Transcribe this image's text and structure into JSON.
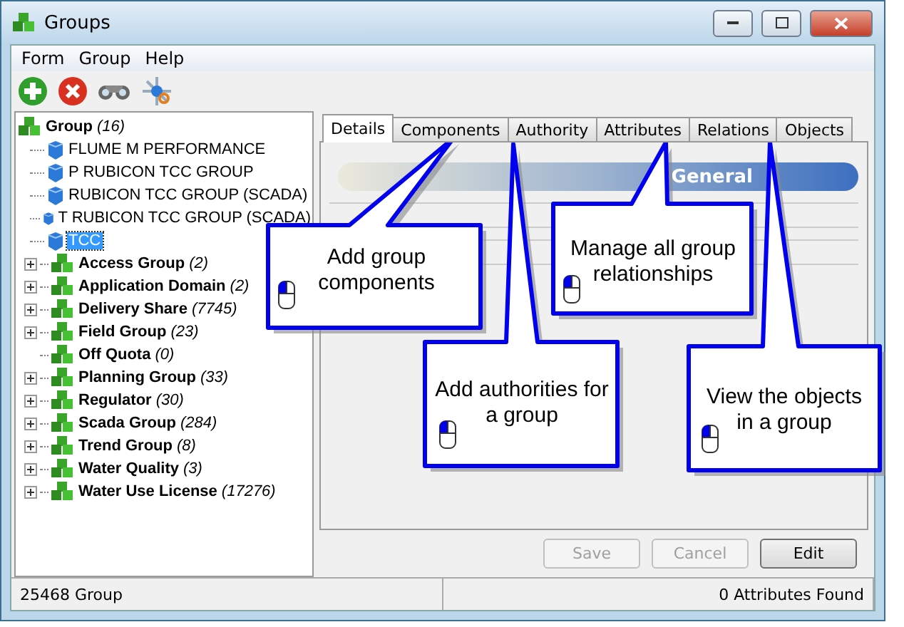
{
  "window": {
    "title": "Groups"
  },
  "menu": [
    "Form",
    "Group",
    "Help"
  ],
  "tree": {
    "label": "Group",
    "count": "(16)",
    "children": [
      {
        "label": "FLUME M PERFORMANCE",
        "kind": "leaf",
        "selected": false
      },
      {
        "label": "P RUBICON TCC GROUP",
        "kind": "leaf",
        "selected": false
      },
      {
        "label": "RUBICON TCC GROUP (SCADA)",
        "kind": "leaf",
        "selected": false
      },
      {
        "label": "T RUBICON TCC GROUP (SCADA)",
        "kind": "leaf",
        "selected": false
      },
      {
        "label": "TCC",
        "kind": "leaf",
        "selected": true
      }
    ]
  },
  "groups": [
    {
      "label": "Access Group",
      "count": "(2)",
      "expandable": true
    },
    {
      "label": "Application Domain",
      "count": "(2)",
      "expandable": true
    },
    {
      "label": "Delivery Share",
      "count": "(7745)",
      "expandable": true
    },
    {
      "label": "Field Group",
      "count": "(23)",
      "expandable": true
    },
    {
      "label": "Off Quota",
      "count": "(0)",
      "expandable": false
    },
    {
      "label": "Planning Group",
      "count": "(33)",
      "expandable": true
    },
    {
      "label": "Regulator",
      "count": "(30)",
      "expandable": true
    },
    {
      "label": "Scada Group",
      "count": "(284)",
      "expandable": true
    },
    {
      "label": "Trend Group",
      "count": "(8)",
      "expandable": true
    },
    {
      "label": "Water Quality",
      "count": "(3)",
      "expandable": true
    },
    {
      "label": "Water Use License",
      "count": "(17276)",
      "expandable": true
    }
  ],
  "tabs": [
    {
      "label": "Details",
      "selected": true
    },
    {
      "label": "Components",
      "selected": false
    },
    {
      "label": "Authority",
      "selected": false
    },
    {
      "label": "Attributes",
      "selected": false
    },
    {
      "label": "Relations",
      "selected": false
    },
    {
      "label": "Objects",
      "selected": false
    }
  ],
  "section": "General",
  "buttons": [
    {
      "label": "Save",
      "disabled": true
    },
    {
      "label": "Cancel",
      "disabled": true
    },
    {
      "label": "Edit",
      "disabled": false
    }
  ],
  "status_bar": [
    "25468 Group",
    "0 Attributes Found"
  ],
  "callouts": [
    "Add group components",
    "Add authorities for a group",
    "Manage all group relationships",
    "View the objects in a group"
  ]
}
